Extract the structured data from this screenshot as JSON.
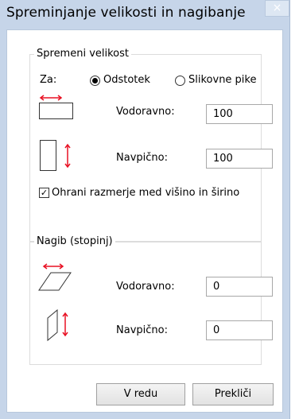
{
  "window": {
    "title": "Spreminjanje velikosti in nagibanje",
    "close_glyph": "×"
  },
  "resize": {
    "group_title": "Spremeni velikost",
    "by_label": "Za:",
    "options": [
      {
        "label": "Odstotek",
        "selected": true
      },
      {
        "label": "Slikovne pike",
        "selected": false
      }
    ],
    "horizontal_label": "Vodoravno:",
    "horizontal_value": "100",
    "vertical_label": "Navpično:",
    "vertical_value": "100",
    "keep_ratio_label": "Ohrani razmerje med višino in širino",
    "keep_ratio_checked": true
  },
  "skew": {
    "group_title": "Nagib (stopinj)",
    "horizontal_label": "Vodoravno:",
    "horizontal_value": "0",
    "vertical_label": "Navpično:",
    "vertical_value": "0"
  },
  "buttons": {
    "ok": "V redu",
    "cancel": "Prekliči"
  },
  "icons": {
    "resize_horizontal": "resize-horizontal-icon",
    "resize_vertical": "resize-vertical-icon",
    "skew_horizontal": "skew-horizontal-icon",
    "skew_vertical": "skew-vertical-icon",
    "arrow_color": "#e81123"
  }
}
